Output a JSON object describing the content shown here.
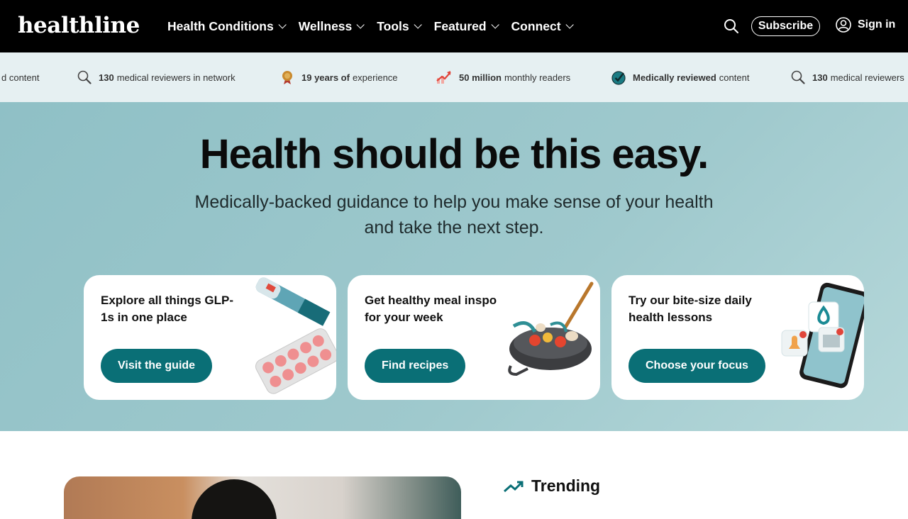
{
  "header": {
    "logo": "healthline",
    "nav": [
      {
        "label": "Health Conditions"
      },
      {
        "label": "Wellness"
      },
      {
        "label": "Tools"
      },
      {
        "label": "Featured"
      },
      {
        "label": "Connect"
      }
    ],
    "subscribe_label": "Subscribe",
    "signin_label": "Sign in",
    "icons": {
      "search": "search-icon",
      "user": "user-icon"
    }
  },
  "ticker": [
    {
      "bold": "",
      "text": "d content",
      "icon": "none"
    },
    {
      "bold": "130",
      "text": "medical reviewers in network",
      "icon": "magnifier-icon"
    },
    {
      "bold": "19 years of",
      "text": "experience",
      "icon": "medal-icon"
    },
    {
      "bold": "50 million",
      "text": "monthly readers",
      "icon": "trend-up-icon"
    },
    {
      "bold": "Medically reviewed",
      "text": "content",
      "icon": "check-badge-icon"
    },
    {
      "bold": "130",
      "text": "medical reviewers",
      "icon": "magnifier-icon"
    }
  ],
  "hero": {
    "title": "Health should be this easy.",
    "subtitle": "Medically-backed guidance to help you make sense of your health and take the next step."
  },
  "cards": [
    {
      "title": "Explore all things GLP-1s in one place",
      "button": "Visit the guide",
      "art": "injection-pen-pills-icon"
    },
    {
      "title": "Get healthy meal inspo for your week",
      "button": "Find recipes",
      "art": "cooking-pan-icon"
    },
    {
      "title": "Try our bite-size daily health lessons",
      "button": "Choose your focus",
      "art": "phone-app-icon"
    }
  ],
  "trending": {
    "label": "Trending",
    "icon": "trending-icon"
  },
  "colors": {
    "nav_bg": "#000000",
    "ticker_bg": "#e6f0f2",
    "hero_bg": "#9fc9cd",
    "accent": "#0a6f76"
  }
}
